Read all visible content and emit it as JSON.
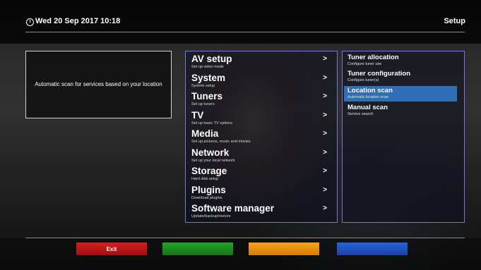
{
  "header": {
    "datetime": "Wed 20 Sep 2017  10:18",
    "title": "Setup",
    "clock_icon": "clock-icon"
  },
  "description": "Automatic scan for services based on your location",
  "menu": {
    "items": [
      {
        "title": "AV setup",
        "subtitle": "Set up video mode",
        "arrow": ">"
      },
      {
        "title": "System",
        "subtitle": "System setup",
        "arrow": ">"
      },
      {
        "title": "Tuners",
        "subtitle": "Set up tuners",
        "arrow": ">"
      },
      {
        "title": "TV",
        "subtitle": "Set up basic TV options",
        "arrow": ">"
      },
      {
        "title": "Media",
        "subtitle": "Set up pictures, music and movies",
        "arrow": ">"
      },
      {
        "title": "Network",
        "subtitle": "Set up your local network",
        "arrow": ">"
      },
      {
        "title": "Storage",
        "subtitle": "Hard disk setup",
        "arrow": ">"
      },
      {
        "title": "Plugins",
        "subtitle": "Download plugins",
        "arrow": ">"
      },
      {
        "title": "Software manager",
        "subtitle": "Update/backup/restore",
        "arrow": ">"
      }
    ]
  },
  "submenu": {
    "selected": "Location scan",
    "items": [
      {
        "title": "Tuner allocation",
        "desc": "Configure tuner use"
      },
      {
        "title": "Tuner configuration",
        "desc": "Configure tuner(s)"
      },
      {
        "title": "Location scan",
        "desc": "Automatic location scan"
      },
      {
        "title": "Manual scan",
        "desc": "Service search"
      }
    ]
  },
  "buttons": {
    "red": "Exit",
    "green": "",
    "yellow": "",
    "blue": ""
  },
  "colors": {
    "red": "#c21818",
    "green": "#1f8c22",
    "yellow": "#ec9210",
    "blue": "#2454c6",
    "selection": "#2f6fb8",
    "panel_border": "#7676e0"
  }
}
